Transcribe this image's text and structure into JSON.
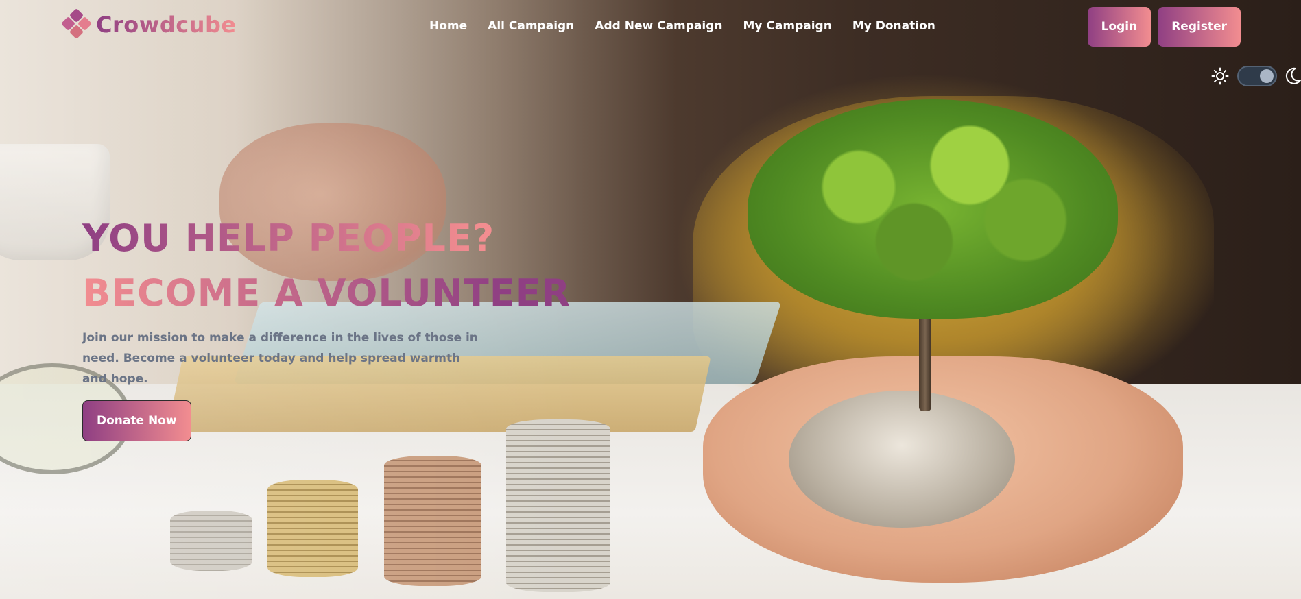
{
  "brand": {
    "name": "Crowdcube"
  },
  "nav": {
    "links": [
      {
        "label": "Home"
      },
      {
        "label": "All Campaign"
      },
      {
        "label": "Add New Campaign"
      },
      {
        "label": "My Campaign"
      },
      {
        "label": "My Donation"
      }
    ]
  },
  "auth": {
    "login_label": "Login",
    "register_label": "Register"
  },
  "theme_toggle": {
    "light_icon": "sun-icon",
    "dark_icon": "moon-icon",
    "mode": "dark"
  },
  "hero": {
    "title_line1": "YOU HELP PEOPLE?",
    "title_line2": "BECOME A VOLUNTEER",
    "description": "Join our mission to make a difference in the lives of those in need. Become a volunteer today and help spread warmth and hope.",
    "cta_label": "Donate Now"
  },
  "colors": {
    "gradient_start": "#8f3f83",
    "gradient_end": "#f28d90",
    "nav_text": "#ffffff",
    "description_text": "#6b7486"
  }
}
